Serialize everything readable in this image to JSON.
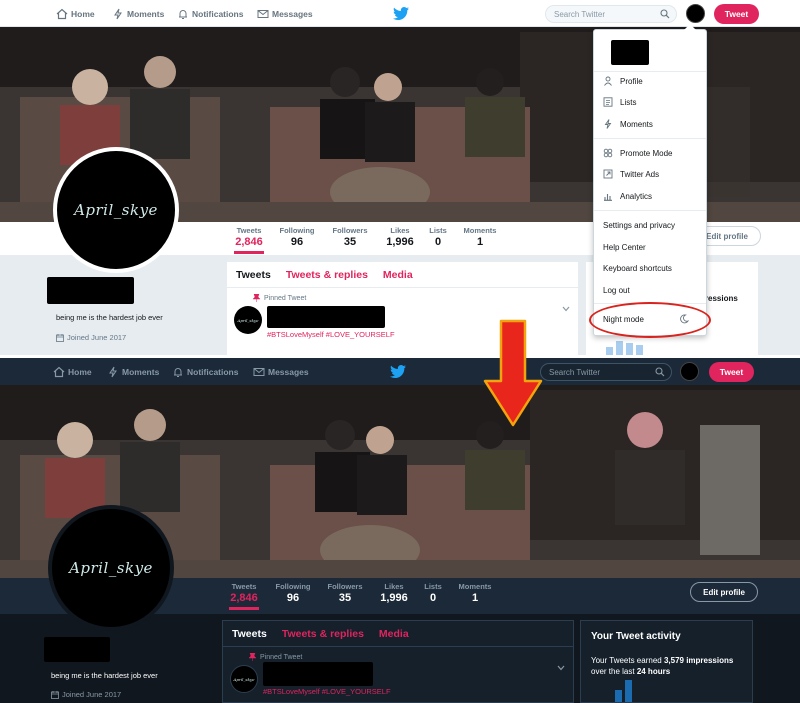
{
  "nav": {
    "home": "Home",
    "moments": "Moments",
    "notifications": "Notifications",
    "messages": "Messages",
    "search_placeholder": "Search Twitter",
    "tweet_button": "Tweet"
  },
  "profile": {
    "avatar_text": "April_skye",
    "bio": "being me is the hardest job ever",
    "joined": "Joined June 2017"
  },
  "stats": [
    {
      "label": "Tweets",
      "value": "2,846"
    },
    {
      "label": "Following",
      "value": "96"
    },
    {
      "label": "Followers",
      "value": "35"
    },
    {
      "label": "Likes",
      "value": "1,996"
    },
    {
      "label": "Lists",
      "value": "0"
    },
    {
      "label": "Moments",
      "value": "1"
    }
  ],
  "edit_profile": "Edit profile",
  "tabs": {
    "tweets": "Tweets",
    "replies": "Tweets & replies",
    "media": "Media"
  },
  "pinned": {
    "label": "Pinned Tweet",
    "avatar_text": "April_skye",
    "hashtags": "#BTSLoveMyself #LOVE_YOURSELF"
  },
  "dropdown": {
    "items": [
      {
        "label": "Profile",
        "icon": "person-icon"
      },
      {
        "label": "Lists",
        "icon": "list-icon"
      },
      {
        "label": "Moments",
        "icon": "bolt-icon"
      },
      {
        "label": "Promote Mode",
        "icon": "promote-icon"
      },
      {
        "label": "Twitter Ads",
        "icon": "external-arrow-icon"
      },
      {
        "label": "Analytics",
        "icon": "bar-chart-icon"
      },
      {
        "label": "Settings and privacy",
        "icon": ""
      },
      {
        "label": "Help Center",
        "icon": ""
      },
      {
        "label": "Keyboard shortcuts",
        "icon": ""
      },
      {
        "label": "Log out",
        "icon": ""
      },
      {
        "label": "Night mode",
        "icon": "moon-icon"
      }
    ]
  },
  "activity": {
    "title": "Your Tweet activity",
    "peek": "pressions",
    "earned_prefix": "Your Tweets earned",
    "impressions": "3,579 impressions",
    "over": "over the last",
    "period": "24 hours"
  },
  "colors": {
    "accent": "#e0245e",
    "twitter_blue": "#1da1f2",
    "night_bg": "#10171e",
    "night_panel": "#1c2938",
    "highlight_red": "#d9231c"
  }
}
